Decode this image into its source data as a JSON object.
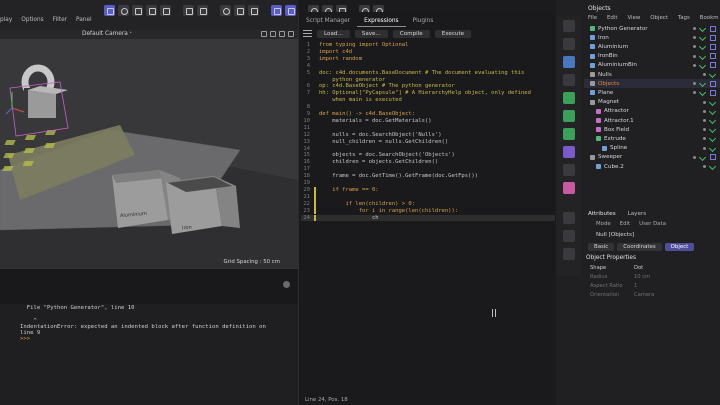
{
  "menu": [
    "play",
    "Options",
    "Filter",
    "Panel"
  ],
  "viewport": {
    "camera_label": "Default Camera",
    "camera_suffix": "ᐩ",
    "grid_spacing": "Grid Spacing : 50 cm",
    "box_label_1": "Aluminium",
    "box_label_2": "Iron"
  },
  "script_manager": {
    "tabs": [
      "Script Manager",
      "Expressions",
      "Plugins"
    ],
    "active_tab": "Expressions",
    "toolbar": [
      "Load...",
      "Save...",
      "Compile",
      "Execute"
    ],
    "status": "Line 24, Pos. 18",
    "code_lines": [
      {
        "n": "1",
        "t": "from typing import Optional"
      },
      {
        "n": "2",
        "t": "import c4d"
      },
      {
        "n": "3",
        "t": "import random"
      },
      {
        "n": "4",
        "t": ""
      },
      {
        "n": "5",
        "t": "doc: c4d.documents.BaseDocument # The document evaluating this"
      },
      {
        "n": "",
        "t": "    python generator"
      },
      {
        "n": "6",
        "t": "op: c4d.BaseObject # The python generator"
      },
      {
        "n": "7",
        "t": "hh: Optional[\"PyCapsule\"] # A HierarchyHelp object, only defined"
      },
      {
        "n": "",
        "t": "    when main is executed"
      },
      {
        "n": "8",
        "t": ""
      },
      {
        "n": "9",
        "t": "def main() -> c4d.BaseObject:"
      },
      {
        "n": "10",
        "t": "    materials = doc.GetMaterials()"
      },
      {
        "n": "11",
        "t": ""
      },
      {
        "n": "12",
        "t": "    nulls = doc.SearchObject('Nulls')"
      },
      {
        "n": "13",
        "t": "    null_children = nulls.GetChildren()"
      },
      {
        "n": "14",
        "t": ""
      },
      {
        "n": "15",
        "t": "    objects = doc.SearchObject('Objects')"
      },
      {
        "n": "16",
        "t": "    children = objects.GetChildren()"
      },
      {
        "n": "17",
        "t": ""
      },
      {
        "n": "18",
        "t": "    frame = doc.GetTime().GetFrame(doc.GetFps())"
      },
      {
        "n": "19",
        "t": ""
      },
      {
        "n": "20",
        "t": "    if frame == 0:"
      },
      {
        "n": "21",
        "t": ""
      },
      {
        "n": "22",
        "t": "        if len(children) > 0:"
      },
      {
        "n": "23",
        "t": "            for i in range(len(children)):"
      },
      {
        "n": "24",
        "t": "                ch"
      }
    ]
  },
  "console": {
    "lines": [
      "  File \"Python Generator\", line 10",
      "",
      "    ^",
      "IndentationError: expected an indented block after function definition on",
      "line 9"
    ],
    "prompt": ">>>"
  },
  "objects_panel": {
    "title": "Objects",
    "menu": [
      "File",
      "Edit",
      "View",
      "Object",
      "Tags",
      "Bookm"
    ],
    "rows": [
      {
        "name": "Python Generator",
        "color": "#d8d8d8",
        "icon": "#4fb87a",
        "indent": 0
      },
      {
        "name": "Iron",
        "color": "#d8d8d8",
        "icon": "#6fa0d8",
        "indent": 0
      },
      {
        "name": "Aluminium",
        "color": "#d8d8d8",
        "icon": "#6fa0d8",
        "indent": 0
      },
      {
        "name": "IronBin",
        "color": "#d8d8d8",
        "icon": "#6fa0d8",
        "indent": 0
      },
      {
        "name": "AluminiumBin",
        "color": "#d8d8d8",
        "icon": "#6fa0d8",
        "indent": 0
      },
      {
        "name": "Nulls",
        "color": "#d8d8d8",
        "icon": "#9a9a9a",
        "indent": 0
      },
      {
        "name": "Objects",
        "color": "#e08a3a",
        "icon": "#9a9a9a",
        "indent": 0
      },
      {
        "name": "Plane",
        "color": "#d8d8d8",
        "icon": "#6fa0d8",
        "indent": 0
      },
      {
        "name": "Magnet",
        "color": "#d8d8d8",
        "icon": "#9a9a9a",
        "indent": 0
      },
      {
        "name": "Attractor",
        "color": "#d8d8d8",
        "icon": "#c76fc7",
        "indent": 1
      },
      {
        "name": "Attractor.1",
        "color": "#d8d8d8",
        "icon": "#c76fc7",
        "indent": 1
      },
      {
        "name": "Box Field",
        "color": "#d8d8d8",
        "icon": "#c76fc7",
        "indent": 1
      },
      {
        "name": "Extrude",
        "color": "#d8d8d8",
        "icon": "#4fb87a",
        "indent": 1
      },
      {
        "name": "Spline",
        "color": "#d8d8d8",
        "icon": "#6fa0d8",
        "indent": 2
      },
      {
        "name": "Sweeper",
        "color": "#d8d8d8",
        "icon": "#9a9a9a",
        "indent": 0
      },
      {
        "name": "Cube.2",
        "color": "#d8d8d8",
        "icon": "#6fa0d8",
        "indent": 1
      }
    ]
  },
  "attributes": {
    "tabs": [
      "Attributes",
      "Layers"
    ],
    "sub_menu": [
      "Mode",
      "Edit",
      "User Data"
    ],
    "object": "Null [Objects]",
    "buttons": [
      "Basic",
      "Coordinates",
      "Object"
    ],
    "active_button": "Object",
    "section": "Object Properties",
    "props": [
      {
        "label": "Shape",
        "value": "Dot"
      },
      {
        "label": "Radius",
        "value": "10 cm"
      },
      {
        "label": "Aspect Ratio",
        "value": "1"
      },
      {
        "label": "Orientation",
        "value": "Camera"
      }
    ]
  },
  "colors": {
    "accent": "#5a5cc8",
    "keyword": "#d7a24d",
    "comment": "#c9b74a",
    "check": "#46c06a",
    "selected_object": "#e08a3a"
  }
}
